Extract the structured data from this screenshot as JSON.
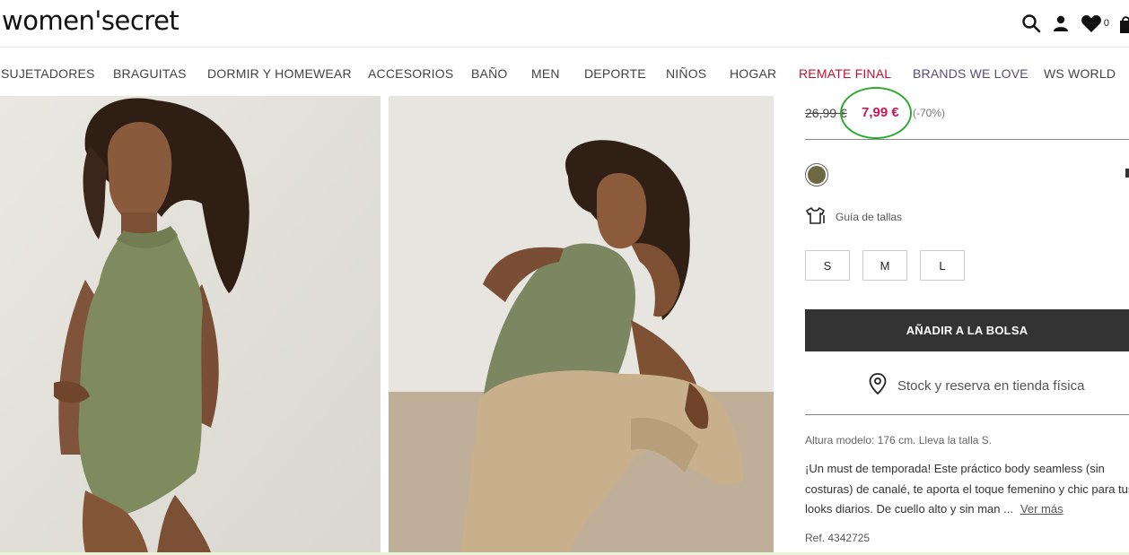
{
  "header": {
    "logo": "women'secret",
    "cart_count": "0"
  },
  "nav": [
    {
      "label": "SUJETADORES"
    },
    {
      "label": "BRAGUITAS"
    },
    {
      "label": "DORMIR Y HOMEWEAR"
    },
    {
      "label": "ACCESORIOS"
    },
    {
      "label": "BAÑO"
    },
    {
      "label": "MEN"
    },
    {
      "label": "DEPORTE"
    },
    {
      "label": "NIÑOS"
    },
    {
      "label": "HOGAR"
    },
    {
      "label": "REMATE FINAL"
    },
    {
      "label": "BRANDS WE LOVE"
    },
    {
      "label": "WS WORLD"
    }
  ],
  "product": {
    "old_price": "26,99 €",
    "price": "7,99 €",
    "discount": "(-70%)",
    "color_swatch": "#6d6a43",
    "size_guide": "Guía de tallas",
    "sizes": [
      "S",
      "M",
      "L"
    ],
    "add_to_bag": "AÑADIR A LA BOLSA",
    "stock": "Stock y reserva en tienda física",
    "model_info": "Altura modelo: 176 cm.  Lleva la talla S.",
    "description": [
      "¡Un must de temporada! Este práctico body seamless (sin",
      "costuras) de canalé, te aporta el toque femenino y chic para tus",
      "looks diarios. De cuello alto y sin man ..."
    ],
    "see_more": "Ver más",
    "ref": "Ref. 4342725"
  },
  "colors": {
    "price": "#c2185b",
    "remate": "#c8102e",
    "brands": "#5a4a7a",
    "highlight": "#2eaa2e",
    "button": "#333333"
  }
}
